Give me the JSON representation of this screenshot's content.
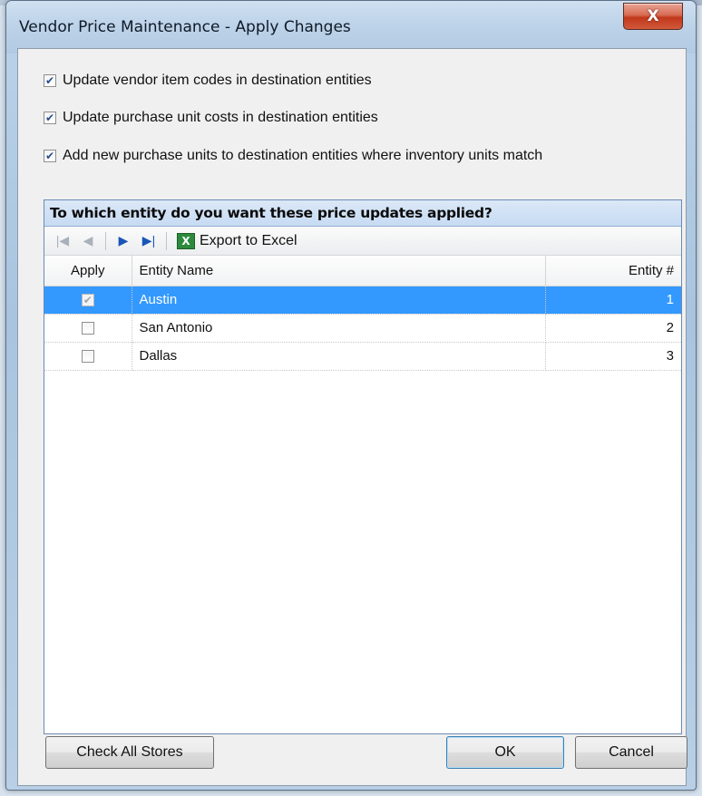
{
  "window": {
    "title": "Vendor Price Maintenance - Apply Changes",
    "close_glyph": "X"
  },
  "options": [
    {
      "label": "Update vendor item codes in destination entities",
      "checked": true
    },
    {
      "label": "Update purchase unit costs in destination entities",
      "checked": true
    },
    {
      "label": "Add new purchase units to destination entities where inventory units match",
      "checked": true
    }
  ],
  "entities_panel": {
    "header": "To which entity do you want these price updates applied?",
    "toolbar": {
      "first_icon": "first-record-icon",
      "prev_icon": "previous-record-icon",
      "next_icon": "next-record-icon",
      "last_icon": "last-record-icon",
      "export_label": "Export to Excel",
      "export_icon": "excel-icon"
    },
    "columns": [
      "Apply",
      "Entity Name",
      "Entity #"
    ],
    "rows": [
      {
        "apply": true,
        "name": "Austin",
        "number": "1",
        "selected": true
      },
      {
        "apply": false,
        "name": "San Antonio",
        "number": "2",
        "selected": false
      },
      {
        "apply": false,
        "name": "Dallas",
        "number": "3",
        "selected": false
      }
    ]
  },
  "buttons": {
    "check_all": "Check All Stores",
    "ok": "OK",
    "cancel": "Cancel"
  },
  "colors": {
    "selection": "#3399ff",
    "panel_header": "#c7dbf3",
    "close_button": "#c2381b"
  }
}
